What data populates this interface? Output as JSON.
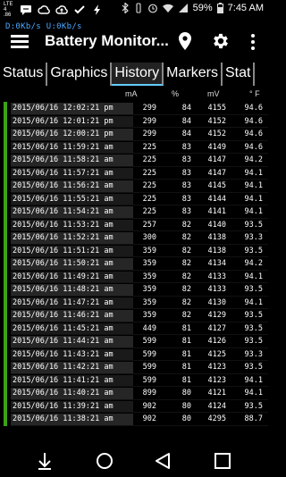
{
  "status_bar": {
    "lte_label": "LTE 4 .86",
    "battery_percent": "59%",
    "time": "7:45 AM"
  },
  "app_bar": {
    "net_speed_down": "D:0Kb/s",
    "net_speed_up": "U:0Kb/s",
    "title": "Battery Monitor..."
  },
  "tabs": [
    {
      "label": "Status"
    },
    {
      "label": "Graphics"
    },
    {
      "label": "History"
    },
    {
      "label": "Markers"
    },
    {
      "label": "Stat"
    }
  ],
  "table": {
    "headers": {
      "ma": "mA",
      "pct": "%",
      "mv": "mV",
      "f": "° F"
    },
    "rows": [
      {
        "date": "2015/06/16 12:02:21 pm",
        "ma": "299",
        "pct": "84",
        "mv": "4155",
        "f": "94.6"
      },
      {
        "date": "2015/06/16 12:01:21 pm",
        "ma": "299",
        "pct": "84",
        "mv": "4152",
        "f": "94.6"
      },
      {
        "date": "2015/06/16 12:00:21 pm",
        "ma": "299",
        "pct": "84",
        "mv": "4152",
        "f": "94.6"
      },
      {
        "date": "2015/06/16 11:59:21 am",
        "ma": "225",
        "pct": "83",
        "mv": "4149",
        "f": "94.6"
      },
      {
        "date": "2015/06/16 11:58:21 am",
        "ma": "225",
        "pct": "83",
        "mv": "4147",
        "f": "94.2"
      },
      {
        "date": "2015/06/16 11:57:21 am",
        "ma": "225",
        "pct": "83",
        "mv": "4147",
        "f": "94.1"
      },
      {
        "date": "2015/06/16 11:56:21 am",
        "ma": "225",
        "pct": "83",
        "mv": "4145",
        "f": "94.1"
      },
      {
        "date": "2015/06/16 11:55:21 am",
        "ma": "225",
        "pct": "83",
        "mv": "4144",
        "f": "94.1"
      },
      {
        "date": "2015/06/16 11:54:21 am",
        "ma": "225",
        "pct": "83",
        "mv": "4141",
        "f": "94.1"
      },
      {
        "date": "2015/06/16 11:53:21 am",
        "ma": "257",
        "pct": "82",
        "mv": "4140",
        "f": "93.5"
      },
      {
        "date": "2015/06/16 11:52:21 am",
        "ma": "300",
        "pct": "82",
        "mv": "4138",
        "f": "93.3"
      },
      {
        "date": "2015/06/16 11:51:21 am",
        "ma": "359",
        "pct": "82",
        "mv": "4138",
        "f": "93.5"
      },
      {
        "date": "2015/06/16 11:50:21 am",
        "ma": "359",
        "pct": "82",
        "mv": "4134",
        "f": "94.2"
      },
      {
        "date": "2015/06/16 11:49:21 am",
        "ma": "359",
        "pct": "82",
        "mv": "4133",
        "f": "94.1"
      },
      {
        "date": "2015/06/16 11:48:21 am",
        "ma": "359",
        "pct": "82",
        "mv": "4133",
        "f": "93.5"
      },
      {
        "date": "2015/06/16 11:47:21 am",
        "ma": "359",
        "pct": "82",
        "mv": "4130",
        "f": "94.1"
      },
      {
        "date": "2015/06/16 11:46:21 am",
        "ma": "359",
        "pct": "82",
        "mv": "4129",
        "f": "93.5"
      },
      {
        "date": "2015/06/16 11:45:21 am",
        "ma": "449",
        "pct": "81",
        "mv": "4127",
        "f": "93.5"
      },
      {
        "date": "2015/06/16 11:44:21 am",
        "ma": "599",
        "pct": "81",
        "mv": "4126",
        "f": "93.5"
      },
      {
        "date": "2015/06/16 11:43:21 am",
        "ma": "599",
        "pct": "81",
        "mv": "4125",
        "f": "93.3"
      },
      {
        "date": "2015/06/16 11:42:21 am",
        "ma": "599",
        "pct": "81",
        "mv": "4123",
        "f": "93.5"
      },
      {
        "date": "2015/06/16 11:41:21 am",
        "ma": "599",
        "pct": "81",
        "mv": "4123",
        "f": "94.1"
      },
      {
        "date": "2015/06/16 11:40:21 am",
        "ma": "899",
        "pct": "80",
        "mv": "4121",
        "f": "94.1"
      },
      {
        "date": "2015/06/16 11:39:21 am",
        "ma": "902",
        "pct": "80",
        "mv": "4124",
        "f": "93.5"
      },
      {
        "date": "2015/06/16 11:38:21 am",
        "ma": "902",
        "pct": "80",
        "mv": "4295",
        "f": "88.7"
      }
    ]
  },
  "colors": {
    "background": "#000000",
    "row_marker_green": "#3aa316",
    "net_speed_blue": "#4aa8ff",
    "tab_active_underline": "#66ccff"
  },
  "icons": {
    "menu": "hamburger-icon",
    "location": "location-pin-icon",
    "settings": "gear-icon",
    "overflow": "more-vert-icon",
    "nav_back": "back-icon",
    "nav_home": "home-icon",
    "nav_recents": "recents-icon",
    "nav_down": "down-arrow-icon"
  }
}
